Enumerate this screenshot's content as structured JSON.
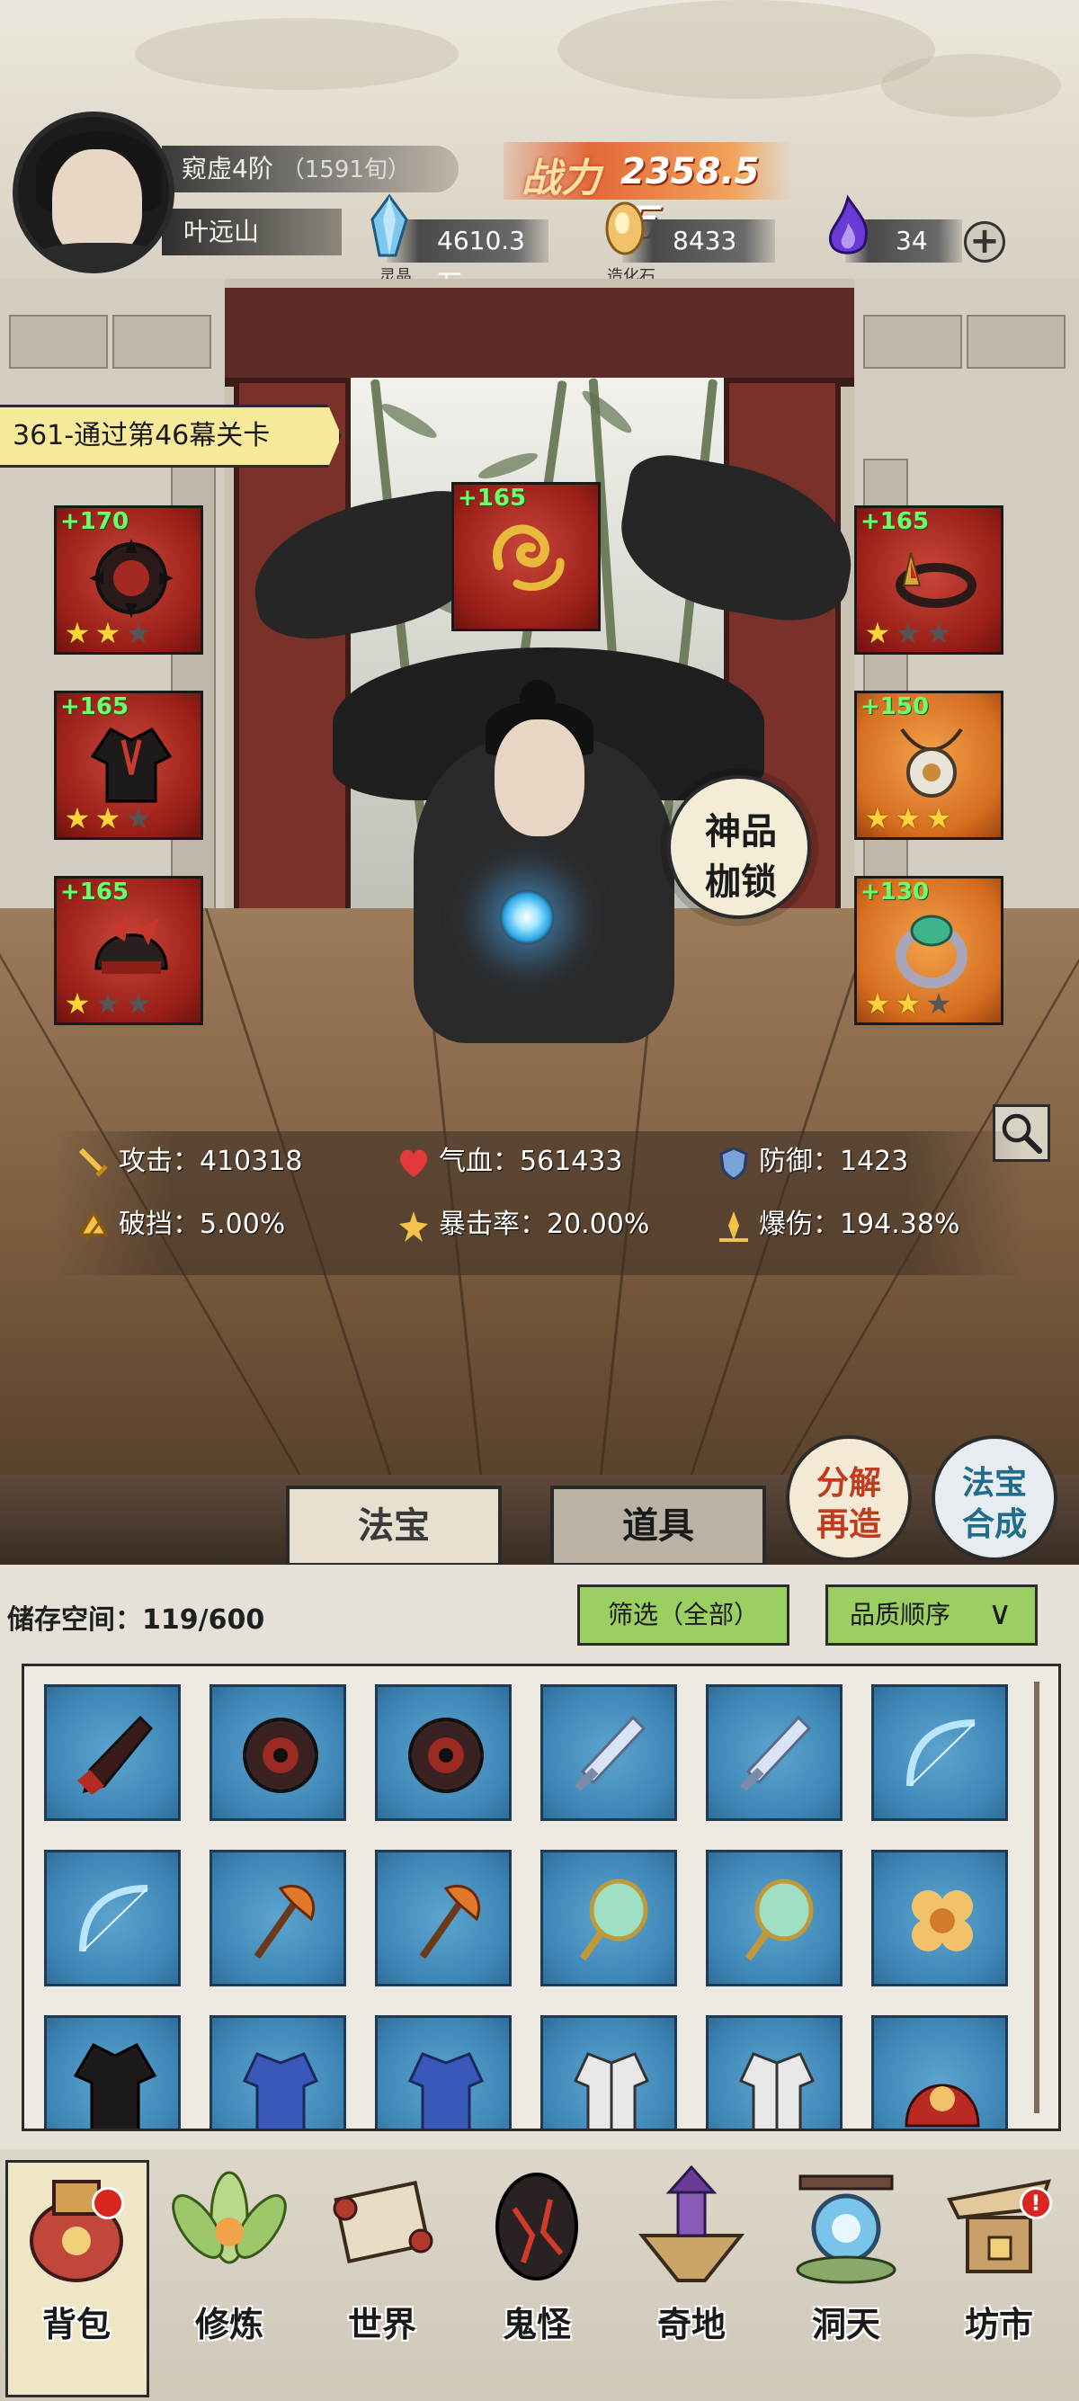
{
  "player": {
    "realm": "窥虚4阶",
    "realm_sub": "（1591旬）",
    "name": "叶远山"
  },
  "power": {
    "label": "战力",
    "value": "2358.5万"
  },
  "resources": [
    {
      "caption": "灵晶",
      "value": "4610.3万",
      "icon": "crystal-icon"
    },
    {
      "caption": "造化石",
      "value": "8433",
      "icon": "creation-stone-icon"
    },
    {
      "caption": "",
      "value": "34",
      "icon": "spirit-flame-icon"
    }
  ],
  "quest": "361-通过第46幕关卡",
  "equip_slots": [
    {
      "bonus": "+170",
      "stars": 2,
      "max_stars": 3,
      "quality": "red",
      "icon": "spiked-wheel-icon"
    },
    {
      "bonus": "+165",
      "stars": 2,
      "max_stars": 3,
      "quality": "red",
      "icon": "dark-robe-icon"
    },
    {
      "bonus": "+165",
      "stars": 1,
      "max_stars": 3,
      "quality": "red",
      "icon": "helmet-icon"
    },
    {
      "bonus": "+165",
      "stars": 0,
      "max_stars": 0,
      "quality": "red",
      "icon": "golden-dragon-icon"
    },
    {
      "bonus": "+165",
      "stars": 1,
      "max_stars": 3,
      "quality": "red",
      "icon": "crown-band-icon"
    },
    {
      "bonus": "+150",
      "stars": 3,
      "max_stars": 3,
      "quality": "orange",
      "icon": "jade-pendant-icon"
    },
    {
      "bonus": "+130",
      "stars": 2,
      "max_stars": 3,
      "quality": "orange",
      "icon": "jade-ring-icon"
    }
  ],
  "seal": {
    "line1": "神品",
    "line2": "枷锁"
  },
  "stats": {
    "attack": {
      "label": "攻击：",
      "value": "410318"
    },
    "hp": {
      "label": "气血：",
      "value": "561433"
    },
    "defense": {
      "label": "防御：",
      "value": "1423"
    },
    "break": {
      "label": "破挡：",
      "value": "5.00%"
    },
    "crit_rate": {
      "label": "暴击率：",
      "value": "20.00%"
    },
    "crit_dmg": {
      "label": "爆伤：",
      "value": "194.38%"
    }
  },
  "tabs": {
    "treasure": "法宝",
    "items": "道具"
  },
  "actions": {
    "decompose": {
      "line1": "分解",
      "line2": "再造"
    },
    "merge": {
      "line1": "法宝",
      "line2": "合成"
    }
  },
  "storage": {
    "label": "储存空间：",
    "value": "119/600",
    "filter": "筛选（全部）",
    "sort": "品质顺序"
  },
  "inventory": [
    "dark-dagger-icon",
    "spiked-wheel-icon",
    "spiked-wheel-icon",
    "crystal-sword-icon",
    "crystal-sword-icon",
    "ice-bow-icon",
    "ice-bow-icon",
    "fire-axe-icon",
    "fire-axe-icon",
    "jade-mirror-icon",
    "jade-mirror-icon",
    "golden-flower-icon",
    "dark-robe-icon",
    "blue-armor-icon",
    "blue-armor-icon",
    "white-armor-icon",
    "white-armor-icon",
    "red-helmet-icon"
  ],
  "nav": [
    {
      "label": "背包",
      "icon": "bag-icon",
      "active": true,
      "badge": ""
    },
    {
      "label": "修炼",
      "icon": "lotus-icon",
      "active": false,
      "badge": ""
    },
    {
      "label": "世界",
      "icon": "scroll-map-icon",
      "active": false,
      "badge": ""
    },
    {
      "label": "鬼怪",
      "icon": "demon-egg-icon",
      "active": false,
      "badge": ""
    },
    {
      "label": "奇地",
      "icon": "floating-island-icon",
      "active": false,
      "badge": ""
    },
    {
      "label": "洞天",
      "icon": "portal-icon",
      "active": false,
      "badge": ""
    },
    {
      "label": "坊市",
      "icon": "market-icon",
      "active": false,
      "badge": "!"
    }
  ],
  "colors": {
    "bonus_green": "#6bff6b",
    "star_gold": "#ffd43a",
    "slot_red": "#9a1f18",
    "slot_orange": "#d66d1f",
    "item_blue": "#3e86b6",
    "filter_green": "#9ccf62"
  }
}
